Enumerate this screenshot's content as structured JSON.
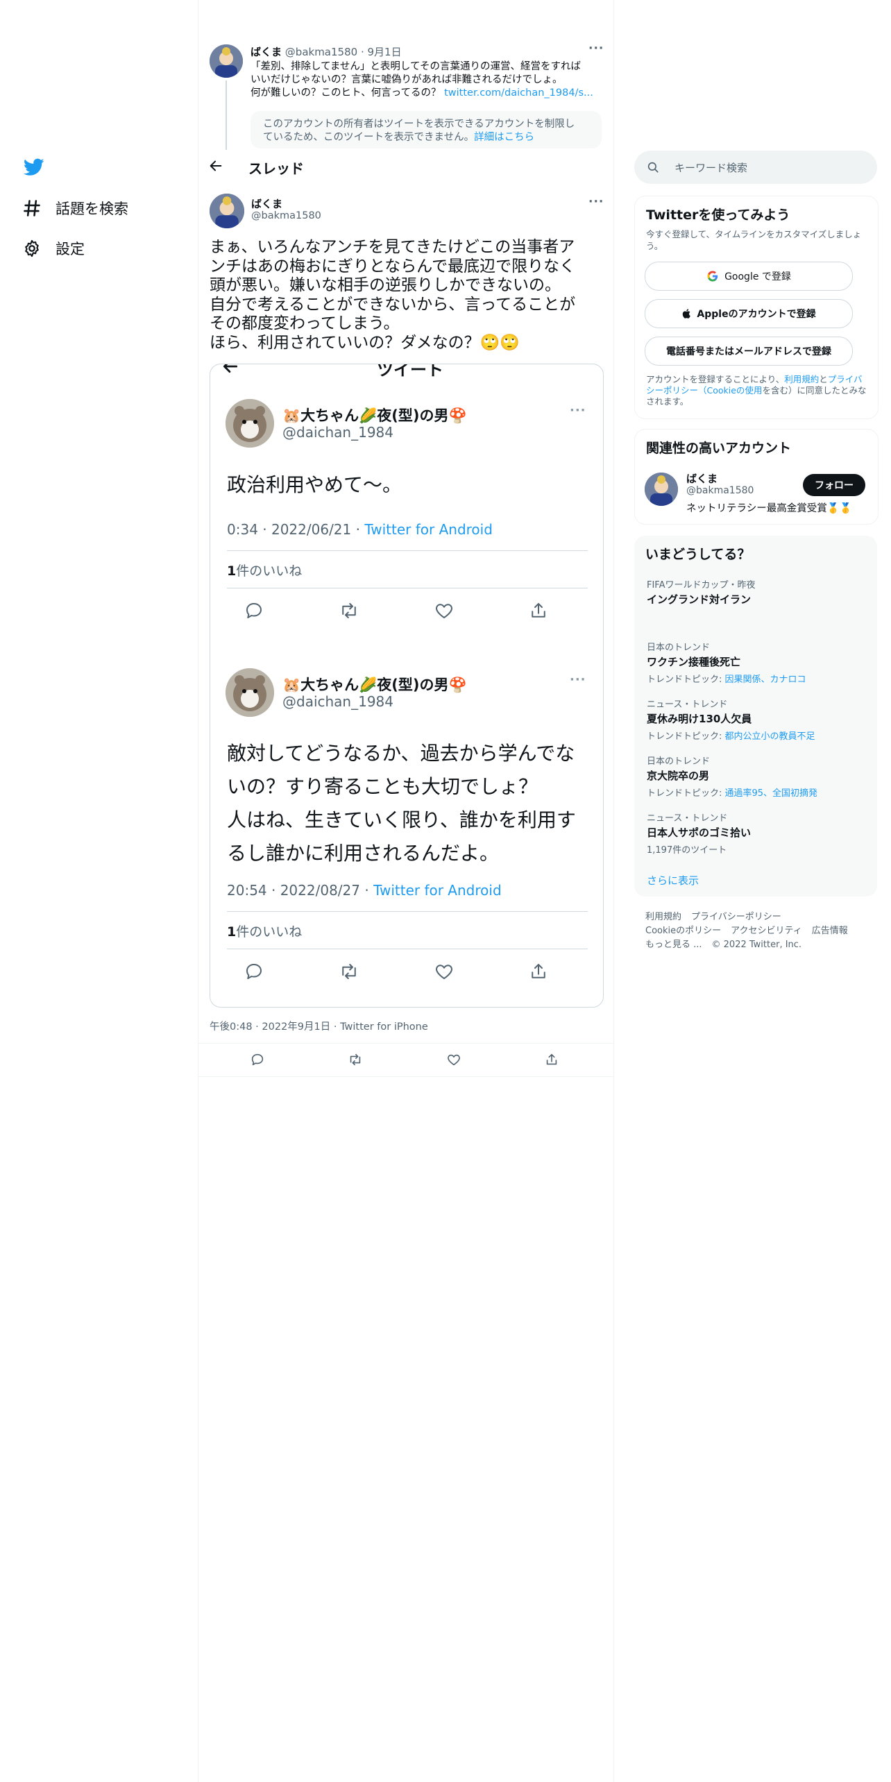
{
  "nav": {
    "explore_label": "話題を検索",
    "settings_label": "設定"
  },
  "parent_tweet": {
    "name": "ばくま",
    "handle": "@bakma1580",
    "date": "· 9月1日",
    "line1": "「差別、排除してません」と表明してその言葉通りの運営、経営をすれば",
    "line2": "いいだけじゃないの？言葉に嘘偽りがあれば非難されるだけでしょ。",
    "line3": "何が難しいの？このヒト、何言ってるの？",
    "link": "twitter.com/daichan_1984/s...",
    "notice_line1": "このアカウントの所有者はツイートを表示できるアカウントを制限し",
    "notice_line2": "ているため、このツイートを表示できません。",
    "notice_link": "詳細はこちら"
  },
  "header": {
    "title": "スレッド"
  },
  "main_tweet": {
    "name": "ばくま",
    "handle": "@bakma1580",
    "lines": [
      "まぁ、いろんなアンチを見てきたけどこの当事者ア",
      "ンチはあの梅おにぎりとならんで最底辺で限りなく",
      "頭が悪い。嫌いな相手の逆張りしかできないの。",
      "自分で考えることができないから、言ってることが",
      "その都度変わってしまう。",
      "ほら、利用されていいの？ダメなの？🙄🙄"
    ],
    "timestamp": "午後0:48 · 2022年9月1日 · Twitter for iPhone"
  },
  "embedded": {
    "header_title": "ツイート",
    "tweets": [
      {
        "name": "🐹大ちゃん🌽夜(型)の男🍄",
        "handle": "@daichan_1984",
        "text_lines": [
          "政治利用やめて〜。"
        ],
        "time": "0:34 · 2022/06/21 · ",
        "source": "Twitter for Android",
        "likes_count": "1",
        "likes_label": "件のいいね"
      },
      {
        "name": "🐹大ちゃん🌽夜(型)の男🍄",
        "handle": "@daichan_1984",
        "text_lines": [
          "敵対してどうなるか、過去から学んでな",
          "いの？すり寄ることも大切でしょ？",
          "人はね、生きていく限り、誰かを利用す",
          "るし誰かに利用されるんだよ。"
        ],
        "time": "20:54 · 2022/08/27 · ",
        "source": "Twitter for Android",
        "likes_count": "1",
        "likes_label": "件のいいね"
      }
    ]
  },
  "search": {
    "placeholder": "キーワード検索"
  },
  "signup": {
    "title": "Twitterを使ってみよう",
    "desc": "今すぐ登録して、タイムラインをカスタマイズしましょう。",
    "google_label": "Google で登録",
    "apple_label": "Appleのアカウントで登録",
    "phone_label": "電話番号またはメールアドレスで登録",
    "terms_prefix": "アカウントを登録することにより、",
    "terms_link1": "利用規約",
    "terms_and": "と",
    "terms_link2": "プライバシーポリシー（Cookieの使用",
    "terms_suffix": "を含む）に同意したとみなされます。"
  },
  "related": {
    "title": "関連性の高いアカウント",
    "name": "ばくま",
    "handle": "@bakma1580",
    "bio": "ネットリテラシー最高金賞受賞🥇🥇",
    "follow_label": "フォロー"
  },
  "trends": {
    "title": "いまどうしてる？",
    "items": [
      {
        "category": "FIFAワールドカップ・昨夜",
        "name": "イングランド対イラン",
        "sub_prefix": "",
        "sub_links": ""
      },
      {
        "category": "日本のトレンド",
        "name": "ワクチン接種後死亡",
        "sub_prefix": "トレンドトピック: ",
        "sub_links": "因果関係、カナロコ"
      },
      {
        "category": "ニュース・トレンド",
        "name": "夏休み明け130人欠員",
        "sub_prefix": "トレンドトピック: ",
        "sub_links": "都内公立小の教員不足"
      },
      {
        "category": "日本のトレンド",
        "name": "京大院卒の男",
        "sub_prefix": "トレンドトピック: ",
        "sub_links": "通過率95、全国初摘発"
      },
      {
        "category": "ニュース・トレンド",
        "name": "日本人サポのゴミ拾い",
        "sub_prefix": "1,197件のツイート",
        "sub_links": ""
      }
    ],
    "more_label": "さらに表示"
  },
  "footer": {
    "terms": "利用規約",
    "privacy": "プライバシーポリシー",
    "cookie": "Cookieのポリシー",
    "accessibility": "アクセシビリティ",
    "ads": "広告情報",
    "more": "もっと見る ...",
    "copyright": "© 2022 Twitter, Inc."
  },
  "colors": {
    "accent": "#1d9bf0",
    "text": "#0f1419",
    "muted": "#536471",
    "border": "#eff3f4",
    "panel": "#f7f9f9"
  }
}
